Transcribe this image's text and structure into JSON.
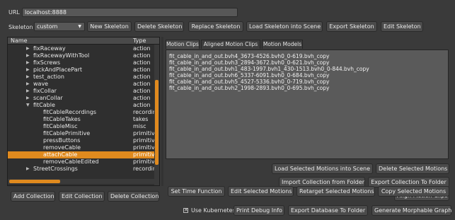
{
  "url": {
    "label": "URL",
    "value": "localhost:8888"
  },
  "skeleton": {
    "label": "Skeleton",
    "selected": "custom"
  },
  "toolbar": {
    "new": "New Skeleton",
    "delete": "Delete Skeleton",
    "replace": "Replace Skeleton",
    "load_into_scene": "Load Skeleton into Scene",
    "export": "Export Skeleton",
    "edit": "Edit Skeleton"
  },
  "tree": {
    "header_name": "Name",
    "header_type": "Type",
    "rows": [
      {
        "name": "fixRaceway",
        "type": "action"
      },
      {
        "name": "fixRacewayWithTool",
        "type": "action"
      },
      {
        "name": "fixScrews",
        "type": "action"
      },
      {
        "name": "pickAndPlacePart",
        "type": "action"
      },
      {
        "name": "test_action",
        "type": "action"
      },
      {
        "name": "wave",
        "type": "action"
      },
      {
        "name": "fixCollar",
        "type": "action"
      },
      {
        "name": "scanCollar",
        "type": "action"
      },
      {
        "name": "fitCable",
        "type": "action"
      },
      {
        "name": "fitCableRecordings",
        "type": "recordin"
      },
      {
        "name": "fitCableTakes",
        "type": "takes"
      },
      {
        "name": "fitCableMisc",
        "type": "misc"
      },
      {
        "name": "fitCablePrimitive",
        "type": "primitive"
      },
      {
        "name": "pressButtons",
        "type": "primitive"
      },
      {
        "name": "removeCable",
        "type": "primitive"
      },
      {
        "name": "attachCable",
        "type": "primitive"
      },
      {
        "name": "removeCableEdited",
        "type": "primitive"
      },
      {
        "name": "StreetCrossings",
        "type": "recordin"
      }
    ]
  },
  "collection_buttons": {
    "add": "Add Collection",
    "edit": "Edit Collection",
    "delete": "Delete Collection"
  },
  "tabs": [
    "Motion Clips",
    "Aligned Motion Clips",
    "Motion Models"
  ],
  "clips": [
    "fit_cable_in_and_out.bvh4_3673-4526.bvh0_0-619.bvh_copy",
    "fit_cable_in_and_out.bvh3_2894-3672.bvh0_0-621.bvh_copy",
    "fit_cable_in_and_out.bvh1_483-1997.bvh1_430-1513.bvh0_0-844.bvh_copy",
    "fit_cable_in_and_out.bvh6_5337-6091.bvh0_0-684.bvh_copy",
    "fit_cable_in_and_out.bvh5_4527-5336.bvh0_0-719.bvh_copy",
    "fit_cable_in_and_out.bvh2_1998-2893.bvh0_0-695.bvh_copy"
  ],
  "actions": {
    "load_selected": "Load Selected Motions into Scene",
    "delete_selected": "Delete Selected Motions",
    "import_collection": "Import Collection from Folder",
    "export_collection": "Export Collection To Folder",
    "align": "Align Motion Clips",
    "set_time": "Set Time Function",
    "edit_selected": "Edit Selected Motions",
    "retarget": "Retarget Selected Motions",
    "copy_selected": "Copy Selected Motions"
  },
  "footer": {
    "kubernetes_label": "Use Kubernetes",
    "print_debug": "Print Debug Info",
    "export_db": "Export Database To Folder",
    "generate_graph": "Generate Morphable Graph"
  }
}
